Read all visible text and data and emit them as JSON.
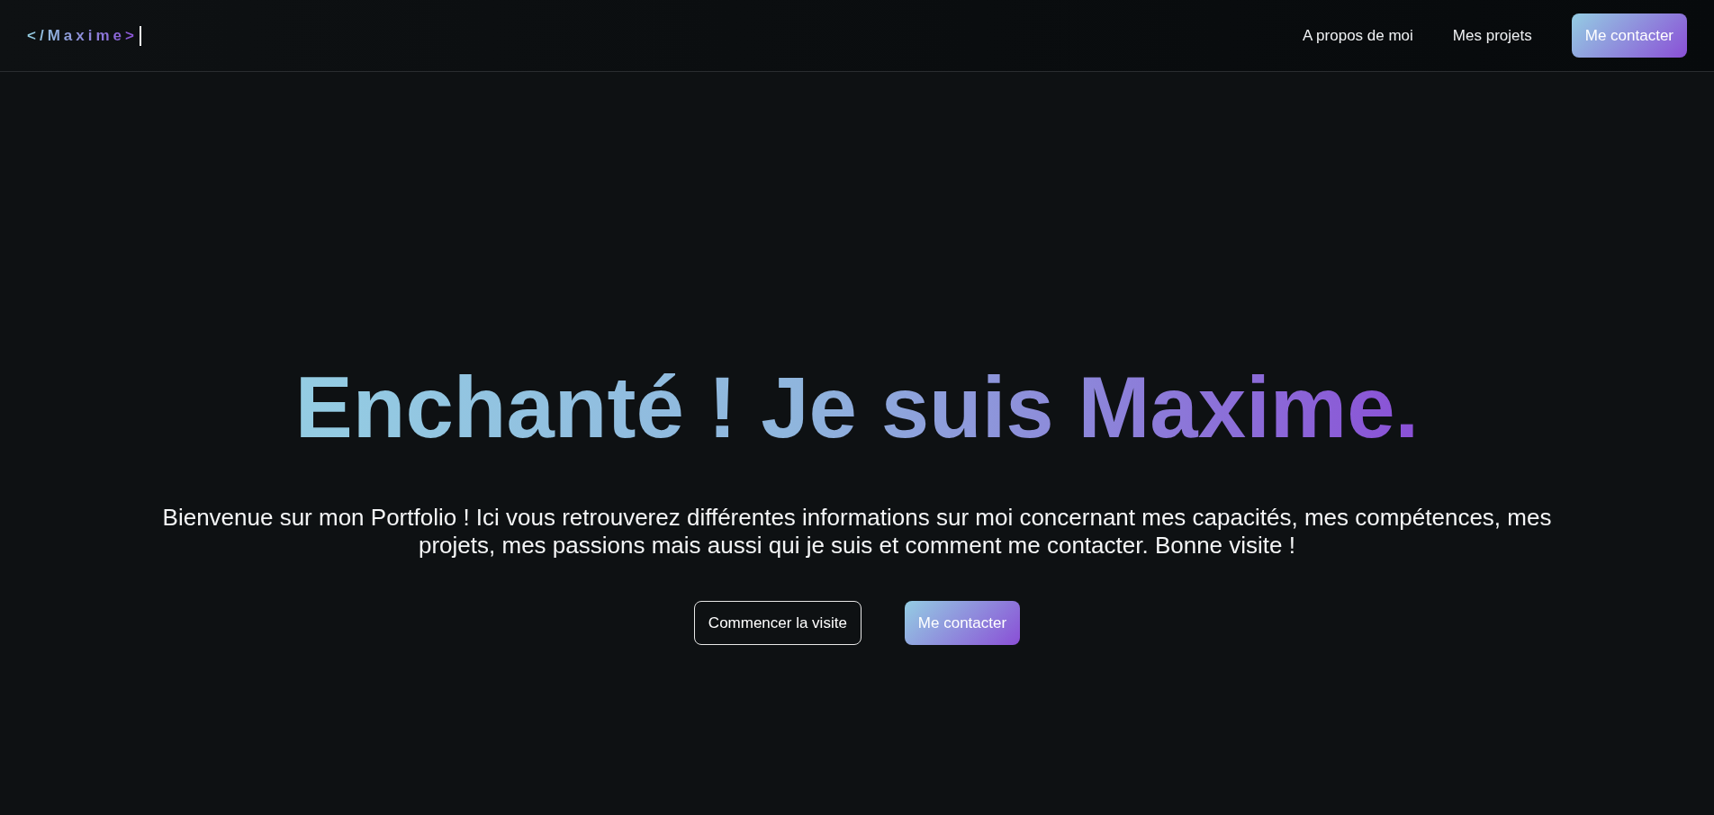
{
  "header": {
    "logo": "</Maxime>",
    "nav": [
      {
        "label": "A propos de moi",
        "kind": "link"
      },
      {
        "label": "Mes projets",
        "kind": "link"
      },
      {
        "label": "Me contacter",
        "kind": "primary"
      }
    ]
  },
  "hero": {
    "title": "Enchanté ! Je suis Maxime.",
    "intro": "Bienvenue sur mon Portfolio ! Ici vous retrouverez différentes informations sur moi concernant mes capacités, mes compétences, mes projets, mes passions mais aussi qui je suis et comment me contacter. Bonne visite !",
    "buttons": [
      {
        "label": "Commencer la visite",
        "kind": "outline"
      },
      {
        "label": "Me contacter",
        "kind": "primary"
      }
    ]
  }
}
